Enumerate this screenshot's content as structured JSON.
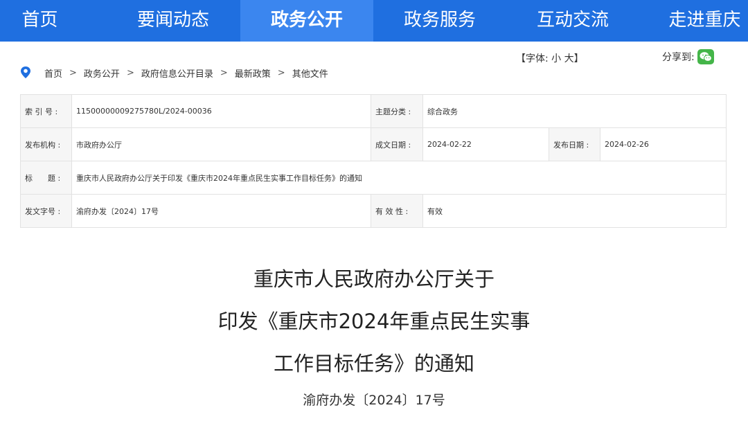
{
  "nav": {
    "items": [
      {
        "label": "首页"
      },
      {
        "label": "要闻动态"
      },
      {
        "label": "政务公开"
      },
      {
        "label": "政务服务"
      },
      {
        "label": "互动交流"
      },
      {
        "label": "走进重庆"
      }
    ],
    "active_index": 2,
    "bg_color": "#1f6fe0",
    "active_color": "#3b86ef"
  },
  "font_control": {
    "open": "【字体:",
    "small": "小",
    "large": "大",
    "close": "】"
  },
  "share": {
    "label": "分享到:",
    "icon": "wechat-icon"
  },
  "breadcrumb": {
    "icon": "location-pin-icon",
    "items": [
      "首页",
      "政务公开",
      "政府信息公开目录",
      "最新政策",
      "其他文件"
    ],
    "separator": ">"
  },
  "info": {
    "index_label": "索 引 号 :",
    "index_value": "11500000009275780L/2024-00036",
    "topic_label": "主题分类 :",
    "topic_value": "综合政务",
    "issuer_label": "发布机构 :",
    "issuer_value": "市政府办公厅",
    "written_label": "成文日期 :",
    "written_value": "2024-02-22",
    "published_label": "发布日期 :",
    "published_value": "2024-02-26",
    "title_label": "标　　题 :",
    "title_value": "重庆市人民政府办公厅关于印发《重庆市2024年重点民生实事工作目标任务》的通知",
    "docno_label": "发文字号 :",
    "docno_value": "渝府办发〔2024〕17号",
    "validity_label": "有 效 性 :",
    "validity_value": "有效"
  },
  "document": {
    "title_lines": [
      "重庆市人民政府办公厅关于",
      "印发《重庆市2024年重点民生实事",
      "工作目标任务》的通知"
    ],
    "number": "渝府办发〔2024〕17号"
  }
}
